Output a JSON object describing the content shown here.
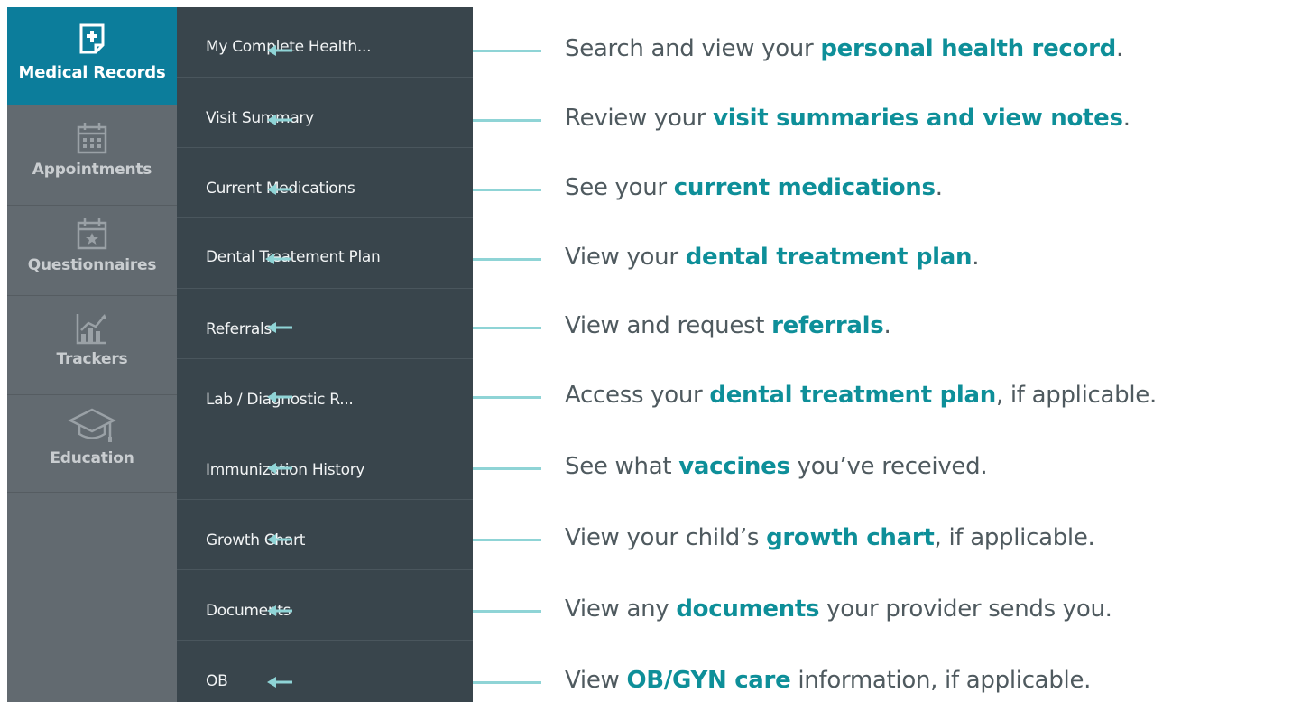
{
  "rail": {
    "items": [
      {
        "label": "Medical Records",
        "icon": "medical-record-icon",
        "active": true
      },
      {
        "label": "Appointments",
        "icon": "calendar-icon",
        "active": false
      },
      {
        "label": "Questionnaires",
        "icon": "calendar-star-icon",
        "active": false
      },
      {
        "label": "Trackers",
        "icon": "chart-icon",
        "active": false
      },
      {
        "label": "Education",
        "icon": "graduation-cap-icon",
        "active": false
      }
    ]
  },
  "submenu": {
    "items": [
      {
        "label": "My Complete Health..."
      },
      {
        "label": "Visit Summary"
      },
      {
        "label": "Current Medications"
      },
      {
        "label": "Dental Treatement Plan"
      },
      {
        "label": "Referrals"
      },
      {
        "label": "Lab / Diagnostic R..."
      },
      {
        "label": "Immunization History"
      },
      {
        "label": "Growth Chart"
      },
      {
        "label": "Documents"
      },
      {
        "label": "OB"
      }
    ]
  },
  "descriptions": [
    {
      "before": "Search and view your ",
      "bold": "personal health record",
      "after": "."
    },
    {
      "before": "Review your ",
      "bold": "visit summaries and view notes",
      "after": "."
    },
    {
      "before": "See your ",
      "bold": "current medications",
      "after": "."
    },
    {
      "before": "View your ",
      "bold": "dental treatment plan",
      "after": "."
    },
    {
      "before": "View and request ",
      "bold": "referrals",
      "after": "."
    },
    {
      "before": "Access your ",
      "bold": "dental treatment plan",
      "after": ", if applicable."
    },
    {
      "before": "See what ",
      "bold": "vaccines",
      "after": " you’ve received."
    },
    {
      "before": "View your child’s ",
      "bold": "growth chart",
      "after": ", if applicable."
    },
    {
      "before": "View any ",
      "bold": "documents",
      "after": " your provider sends you."
    },
    {
      "before": "View ",
      "bold": "OB/GYN care",
      "after": " information, if applicable."
    }
  ],
  "colors": {
    "rail_bg": "#626a70",
    "rail_active": "#0c7d9b",
    "submenu_bg": "#39454c",
    "accent": "#0e8f99",
    "connector": "#8fd4d6"
  }
}
